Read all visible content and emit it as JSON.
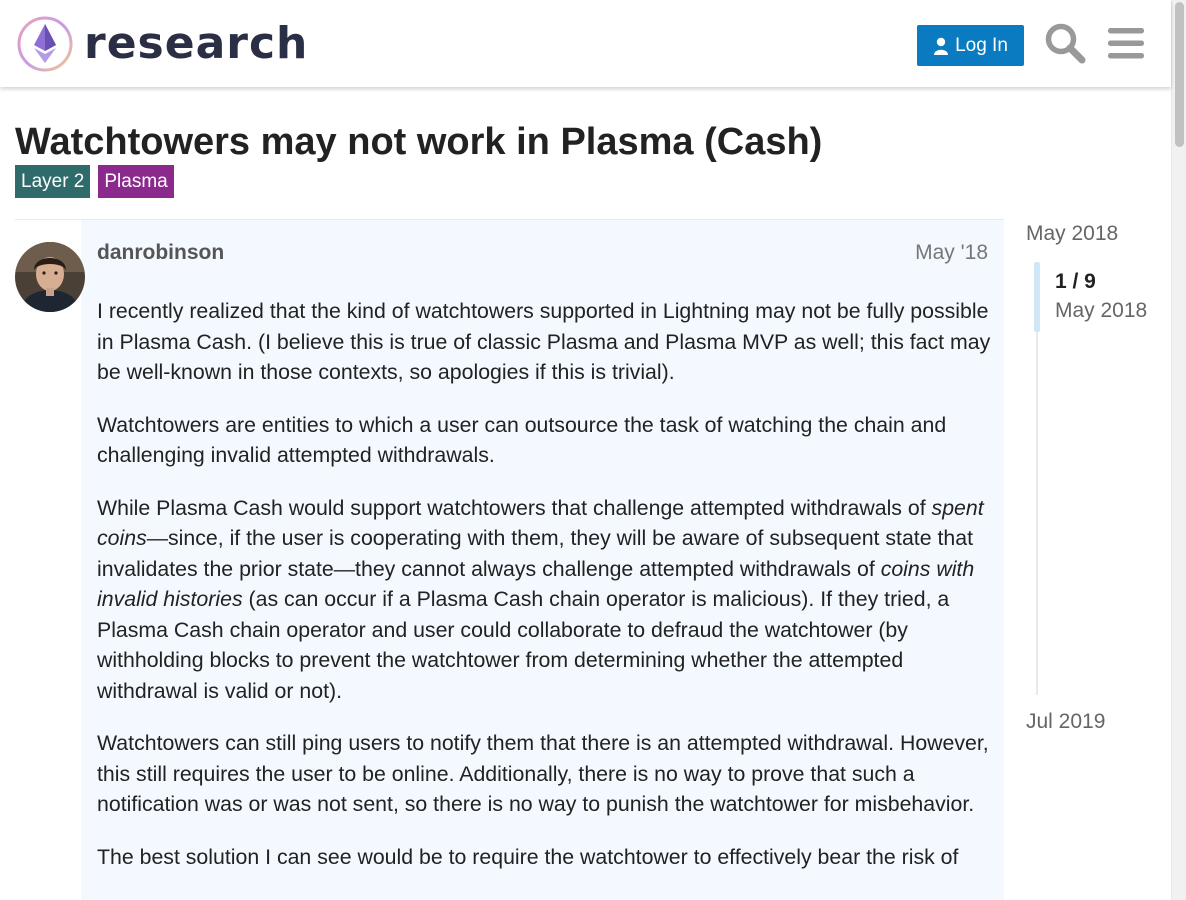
{
  "header": {
    "site_name": "research",
    "login_label": "Log In"
  },
  "topic": {
    "title": "Watchtowers may not work in Plasma (Cash)",
    "tags": [
      {
        "label": "Layer 2",
        "color": "#2f6b6b"
      },
      {
        "label": "Plasma",
        "color": "#8b2a8c"
      }
    ]
  },
  "post": {
    "author": "danrobinson",
    "date": "May '18",
    "paragraphs": {
      "p1": "I recently realized that the kind of watchtowers supported in Lightning may not be fully possible in Plasma Cash. (I believe this is true of classic Plasma and Plasma MVP as well; this fact may be well-known in those contexts, so apologies if this is trivial).",
      "p2": "Watchtowers are entities to which a user can outsource the task of watching the chain and challenging invalid attempted withdrawals.",
      "p3a": "While Plasma Cash would support watchtowers that challenge attempted withdrawals of ",
      "p3b": "spent coins",
      "p3c": "—since, if the user is cooperating with them, they will be aware of subsequent state that invalidates the prior state—they cannot always challenge attempted withdrawals of ",
      "p3d": "coins with invalid histories",
      "p3e": " (as can occur if a Plasma Cash chain operator is malicious). If they tried, a Plasma Cash chain operator and user could collaborate to defraud the watchtower (by withholding blocks to prevent the watchtower from determining whether the attempted withdrawal is valid or not).",
      "p4": "Watchtowers can still ping users to notify them that there is an attempted withdrawal. However, this still requires the user to be online. Additionally, there is no way to prove that such a notification was or was not sent, so there is no way to punish the watchtower for misbehavior.",
      "p5": "The best solution I can see would be to require the watchtower to effectively bear the risk of"
    }
  },
  "timeline": {
    "start": "May 2018",
    "position": "1 / 9",
    "position_date": "May 2018",
    "end": "Jul 2019"
  },
  "colors": {
    "brand_button": "#0a7bc1",
    "post_background": "#f3f9ff"
  },
  "icons": [
    "ethereum-logo-icon",
    "user-icon",
    "search-icon",
    "hamburger-menu-icon"
  ]
}
